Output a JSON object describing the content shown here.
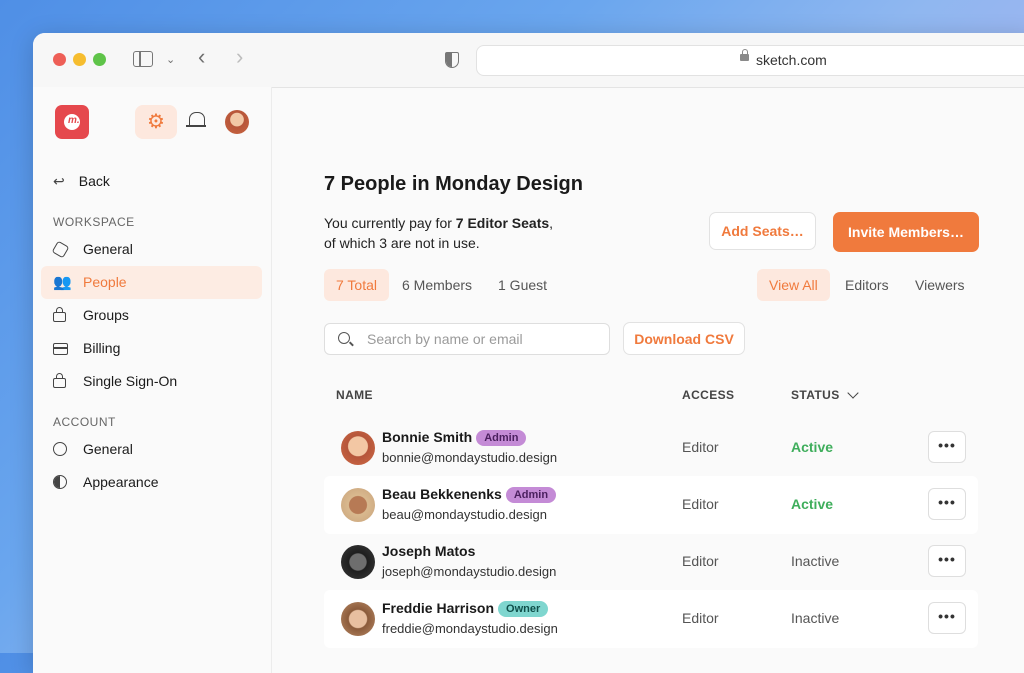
{
  "browser": {
    "url": "sketch.com",
    "icons": [
      "sidebar-toggle-icon",
      "chevron-down-icon",
      "back-arrow-icon",
      "forward-arrow-icon",
      "shield-icon",
      "lock-icon"
    ]
  },
  "sidebar": {
    "back_label": "Back",
    "workspace_label": "WORKSPACE",
    "workspace_items": [
      {
        "label": "General",
        "icon": "hexagon-icon"
      },
      {
        "label": "People",
        "icon": "people-icon",
        "active": true
      },
      {
        "label": "Groups",
        "icon": "lock-icon"
      },
      {
        "label": "Billing",
        "icon": "card-icon"
      },
      {
        "label": "Single Sign-On",
        "icon": "lock-icon"
      }
    ],
    "account_label": "ACCOUNT",
    "account_items": [
      {
        "label": "General",
        "icon": "user-circle-icon"
      },
      {
        "label": "Appearance",
        "icon": "half-circle-icon"
      }
    ],
    "logo_letter": "m."
  },
  "main": {
    "title": "7 People in Monday Design",
    "subtitle_pre": "You currently pay for ",
    "subtitle_bold": "7 Editor Seats",
    "subtitle_post": ",",
    "subtitle_line2": "of which 3 are not in use.",
    "add_seats_label": "Add Seats…",
    "invite_label": "Invite Members…",
    "filters_left": [
      "7 Total",
      "6 Members",
      "1 Guest"
    ],
    "filters_right": [
      "View All",
      "Editors",
      "Viewers"
    ],
    "search_placeholder": "Search by name or email",
    "download_label": "Download CSV",
    "columns": {
      "name": "NAME",
      "access": "ACCESS",
      "status": "STATUS"
    },
    "members": [
      {
        "name": "Bonnie Smith",
        "badge": "Admin",
        "email": "bonnie@mondaystudio.design",
        "access": "Editor",
        "status": "Active"
      },
      {
        "name": "Beau Bekkenenks",
        "badge": "Admin",
        "email": "beau@mondaystudio.design",
        "access": "Editor",
        "status": "Active"
      },
      {
        "name": "Joseph Matos",
        "badge": "",
        "email": "joseph@mondaystudio.design",
        "access": "Editor",
        "status": "Inactive"
      },
      {
        "name": "Freddie Harrison",
        "badge": "Owner",
        "email": "freddie@mondaystudio.design",
        "access": "Editor",
        "status": "Inactive"
      }
    ],
    "more_label": "•••"
  },
  "colors": {
    "accent": "#f07a3d",
    "active_status": "#3fae5c",
    "admin_badge": "#c48bd6",
    "owner_badge": "#7fd6cf",
    "logo": "#e5484d"
  }
}
